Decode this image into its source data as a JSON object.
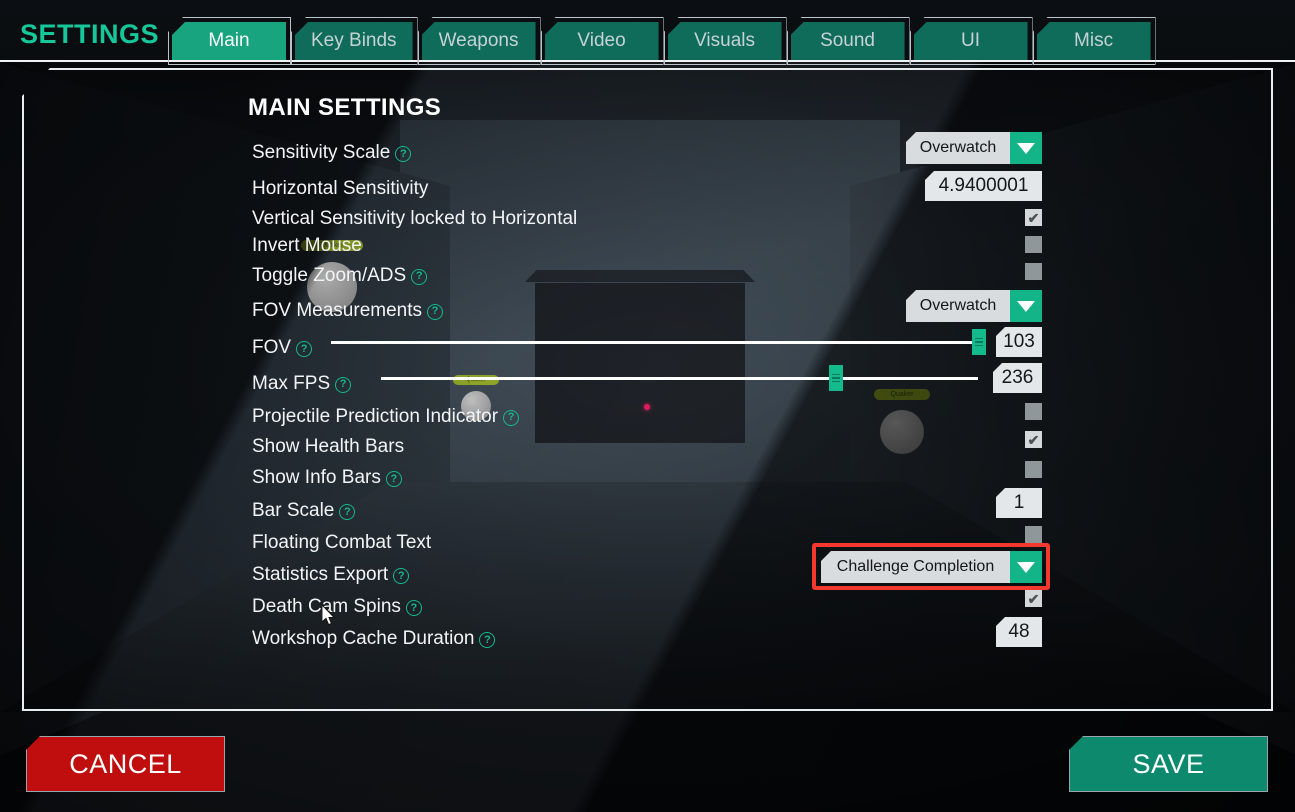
{
  "header": {
    "title": "SETTINGS",
    "tabs": [
      {
        "label": "Main",
        "active": true
      },
      {
        "label": "Key Binds",
        "active": false
      },
      {
        "label": "Weapons",
        "active": false
      },
      {
        "label": "Video",
        "active": false
      },
      {
        "label": "Visuals",
        "active": false
      },
      {
        "label": "Sound",
        "active": false
      },
      {
        "label": "UI",
        "active": false
      },
      {
        "label": "Misc",
        "active": false
      }
    ]
  },
  "panel": {
    "title": "MAIN SETTINGS",
    "rows": [
      {
        "label": "Sensitivity Scale",
        "help": true,
        "control": "dropdown",
        "value": "Overwatch"
      },
      {
        "label": "Horizontal Sensitivity",
        "help": false,
        "control": "number",
        "value": "4.9400001"
      },
      {
        "label": "Vertical Sensitivity locked to Horizontal",
        "help": false,
        "control": "checkbox",
        "value": "checked"
      },
      {
        "label": "Invert Mouse",
        "help": false,
        "control": "checkbox",
        "value": "unchecked"
      },
      {
        "label": "Toggle Zoom/ADS",
        "help": true,
        "control": "checkbox",
        "value": "unchecked"
      },
      {
        "label": "FOV Measurements",
        "help": true,
        "control": "dropdown",
        "value": "Overwatch"
      },
      {
        "label": "FOV",
        "help": true,
        "control": "slider",
        "value": "103"
      },
      {
        "label": "Max FPS",
        "help": true,
        "control": "slider",
        "value": "236"
      },
      {
        "label": "Projectile Prediction Indicator",
        "help": true,
        "control": "checkbox",
        "value": "unchecked"
      },
      {
        "label": "Show Health Bars",
        "help": false,
        "control": "checkbox",
        "value": "checked"
      },
      {
        "label": "Show Info Bars",
        "help": true,
        "control": "checkbox",
        "value": "unchecked"
      },
      {
        "label": "Bar Scale",
        "help": true,
        "control": "number",
        "value": "1"
      },
      {
        "label": "Floating Combat Text",
        "help": false,
        "control": "checkbox",
        "value": "unchecked"
      },
      {
        "label": "Statistics Export",
        "help": true,
        "control": "dropdown",
        "value": "Challenge Completion",
        "highlighted": true
      },
      {
        "label": "Death Cam Spins",
        "help": true,
        "control": "checkbox",
        "value": "checked"
      },
      {
        "label": "Workshop Cache Duration",
        "help": true,
        "control": "number",
        "value": "48"
      }
    ],
    "help_glyph": "?"
  },
  "controls": {
    "sensitivity_scale_value": "Overwatch",
    "horizontal_sensitivity_value": "4.9400001",
    "fov_measurements_value": "Overwatch",
    "fov_value": "103",
    "max_fps_value": "236",
    "bar_scale_value": "1",
    "statistics_export_value": "Challenge Completion",
    "workshop_cache_duration_value": "48",
    "check_glyph": "✔"
  },
  "footer": {
    "cancel_label": "CANCEL",
    "save_label": "SAVE"
  },
  "scene": {
    "bot_tags": [
      "Quaker",
      "Quaker",
      "Quaker"
    ]
  },
  "colors": {
    "accent_green": "#16c79a",
    "tab_green": "#0f6b5a",
    "tab_active_green": "#17a47f",
    "dropdown_arrow_green": "#13b488",
    "slider_green": "#14b98c",
    "highlight_red": "#f2382f",
    "cancel_red": "#c00d0d",
    "save_green": "#0d8a6d",
    "help_teal": "#12b98c",
    "bot_tag_green": "#96b024",
    "pellet_pink": "#e0165c"
  }
}
